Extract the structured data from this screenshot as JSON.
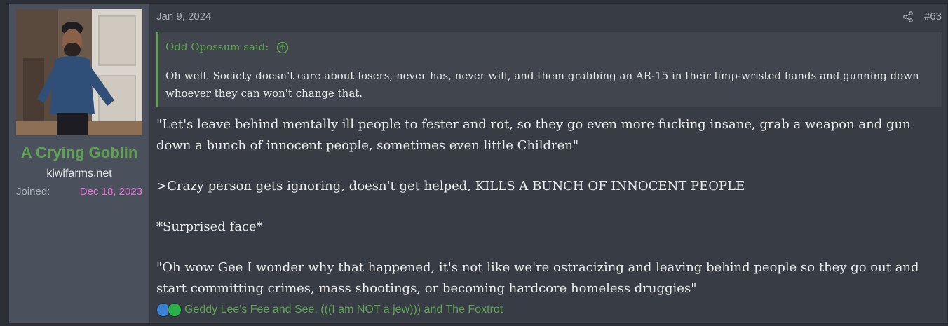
{
  "user": {
    "name": "A Crying Goblin",
    "title": "kiwifarms.net",
    "joined_label": "Joined:",
    "joined_date": "Dec 18, 2023"
  },
  "post": {
    "date": "Jan 9, 2024",
    "number": "#63"
  },
  "quote": {
    "attribution": "Odd Opossum said:",
    "text": "Oh well. Society doesn't care about losers, never has, never will, and them grabbing an AR-15 in their limp-wristed hands and gunning down whoever they can won't change that."
  },
  "body": {
    "paragraphs": [
      "\"Let's leave behind mentally ill people to fester and rot, so they go even more fucking insane, grab a weapon and gun down a bunch of innocent people, sometimes even little Children\"",
      ">Crazy person gets ignoring, doesn't get helped, KILLS A BUNCH OF INNOCENT PEOPLE",
      "*Surprised face*",
      "\"Oh wow Gee I wonder why that happened, it's not like we're ostracizing and leaving behind people so they go out and start committing crimes, mass shootings, or becoming hardcore homeless druggies\""
    ]
  },
  "reactions": {
    "text": "Geddy Lee's Fee and See, (((I am NOT a jew))) and The Foxtrot",
    "icons": [
      "like-icon",
      "check-icon"
    ]
  },
  "colors": {
    "accent_green": "#5fa352",
    "joined_pink": "#e672d4",
    "user_cell_bg": "#4b515c",
    "post_bg": "#383c45"
  }
}
